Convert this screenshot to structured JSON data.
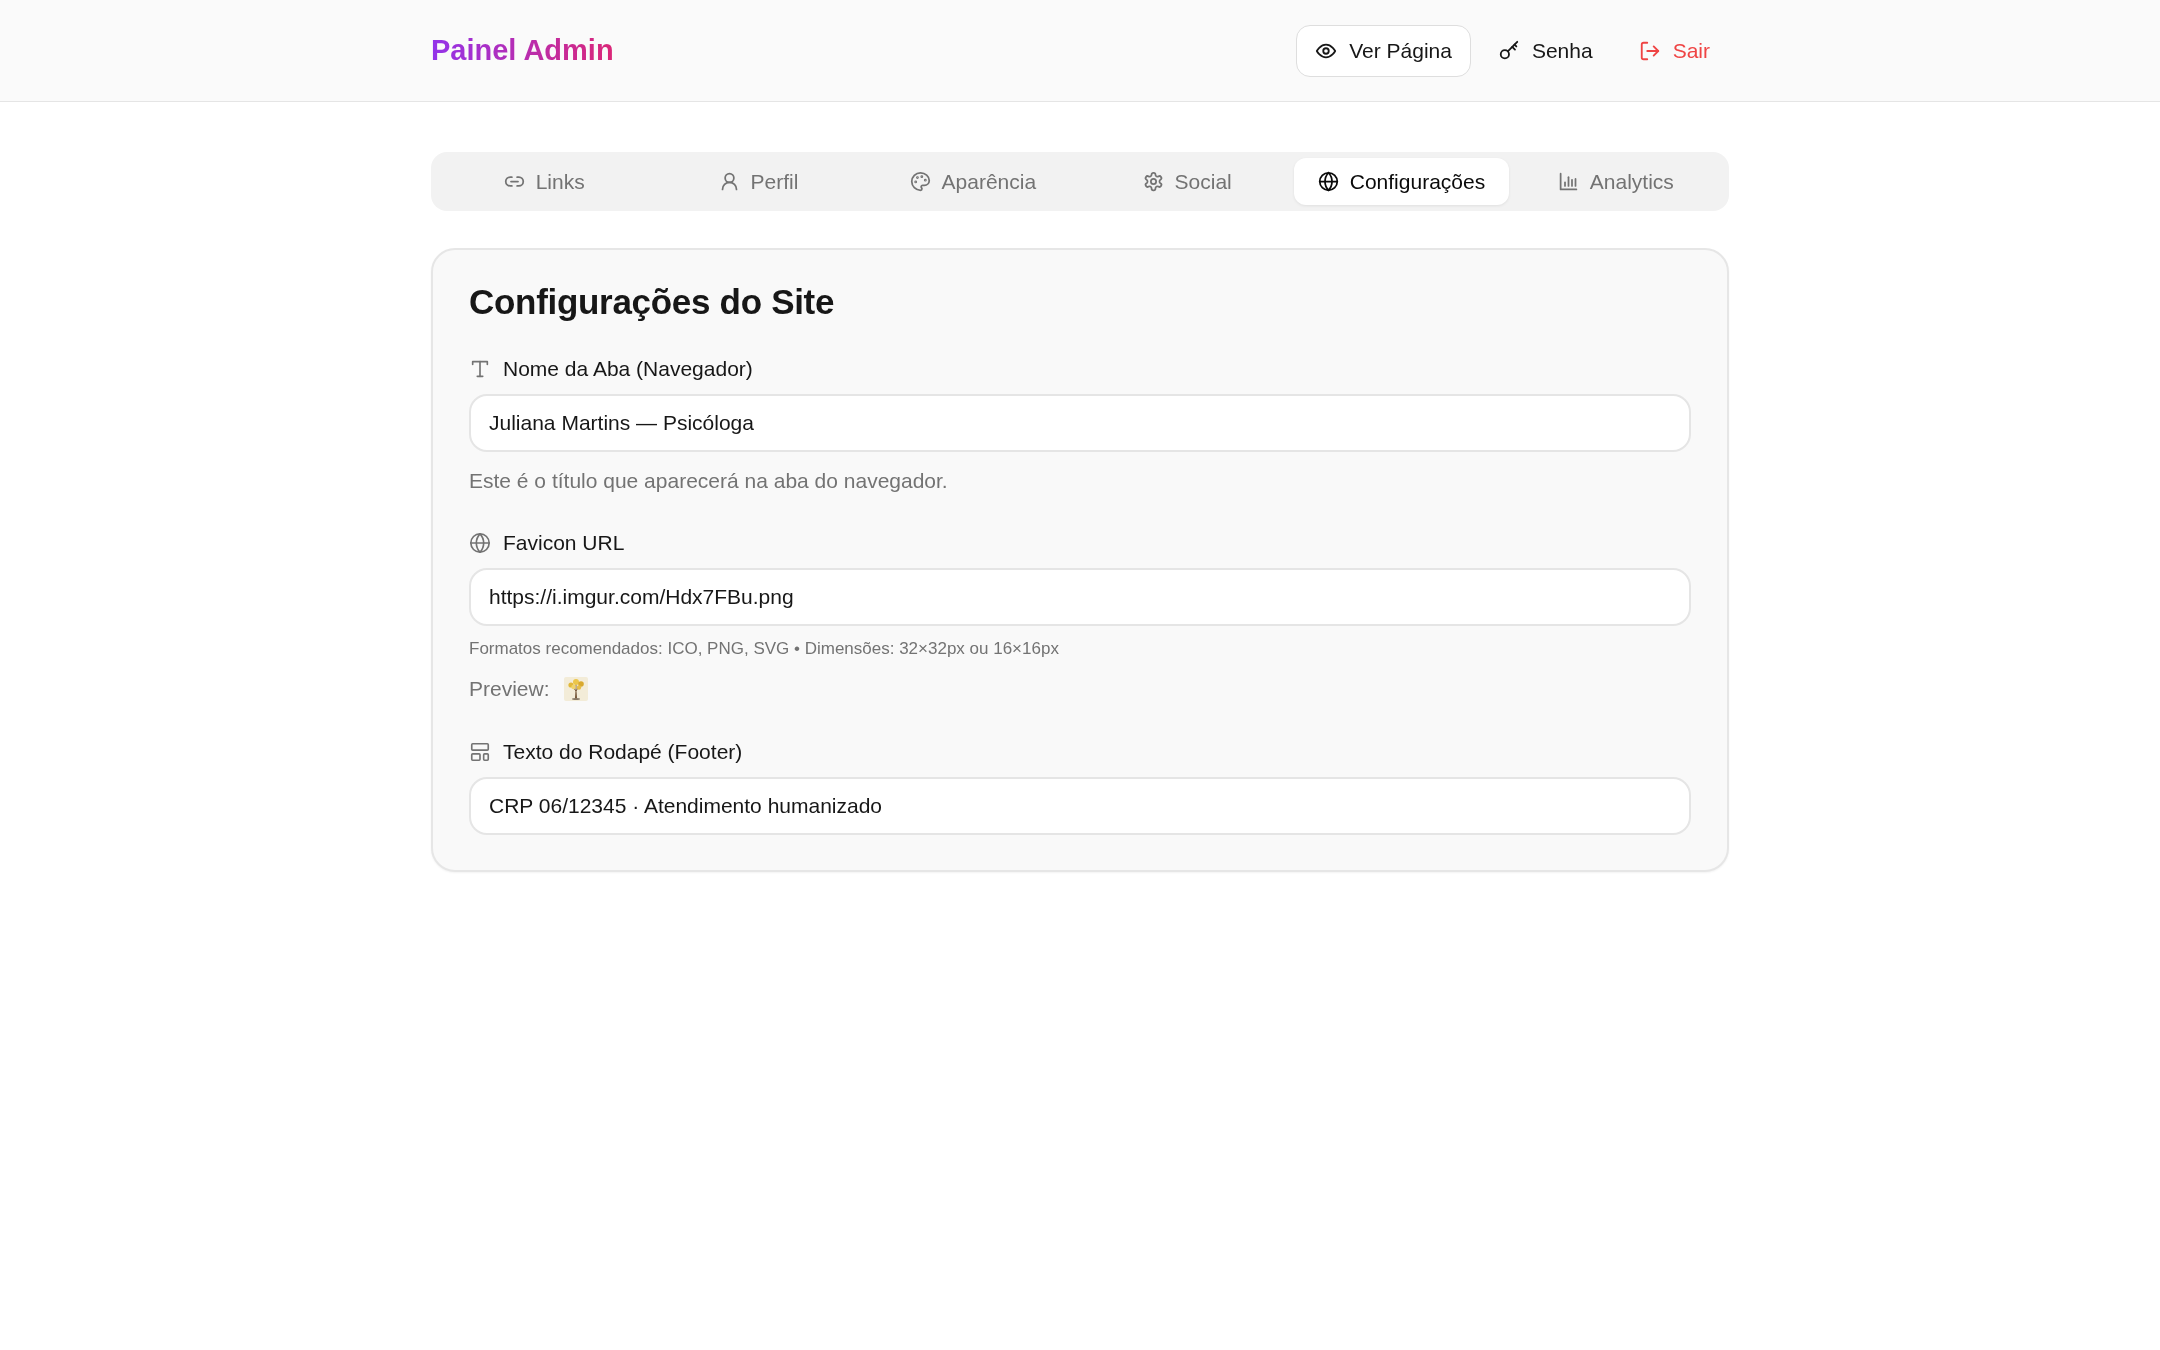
{
  "header": {
    "title": "Painel Admin",
    "actions": [
      {
        "label": "Ver Página",
        "kind": "outline"
      },
      {
        "label": "Senha",
        "kind": "plain"
      },
      {
        "label": "Sair",
        "kind": "danger"
      }
    ]
  },
  "tabs": [
    {
      "label": "Links",
      "selected": false
    },
    {
      "label": "Perfil",
      "selected": false
    },
    {
      "label": "Aparência",
      "selected": false
    },
    {
      "label": "Social",
      "selected": false
    },
    {
      "label": "Configurações",
      "selected": true
    },
    {
      "label": "Analytics",
      "selected": false
    }
  ],
  "settings_card": {
    "title": "Configurações do Site",
    "fields": [
      {
        "label": "Nome da Aba (Navegador)",
        "value": "Juliana Martins — Psicóloga",
        "help": "Este é o título que aparecerá na aba do navegador."
      },
      {
        "label": "Favicon URL",
        "value": "https://i.imgur.com/Hdx7FBu.png",
        "note": "Formatos recomendados: ICO, PNG, SVG • Dimensões: 32×32px ou 16×16px",
        "preview_label": "Preview:"
      },
      {
        "label": "Texto do Rodapé (Footer)",
        "value": "CRP 06/12345 · Atendimento humanizado"
      }
    ]
  }
}
